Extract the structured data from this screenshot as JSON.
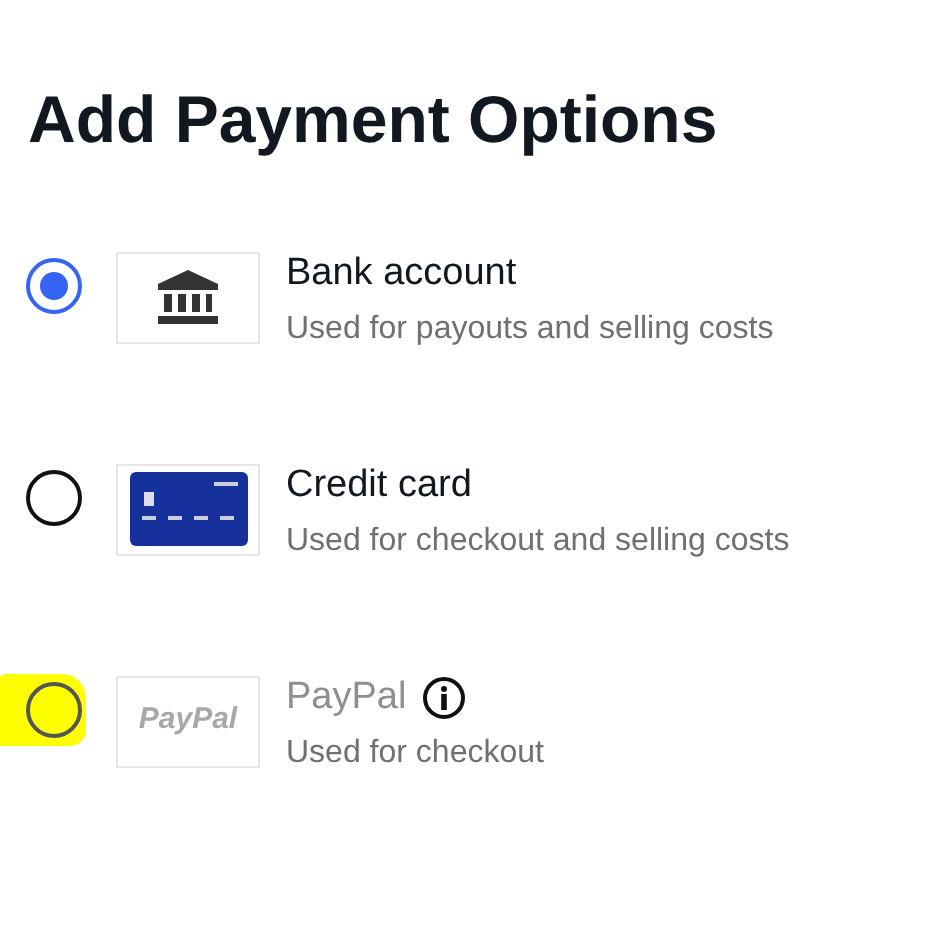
{
  "title": "Add Payment Options",
  "options": [
    {
      "kind": "bank",
      "label": "Bank account",
      "description": "Used for payouts and selling costs",
      "selected": true,
      "disabled": false,
      "highlighted": false,
      "info": false
    },
    {
      "kind": "card",
      "label": "Credit card",
      "description": "Used for checkout and selling costs",
      "selected": false,
      "disabled": false,
      "highlighted": false,
      "info": false
    },
    {
      "kind": "paypal",
      "label": "PayPal",
      "logo_text": "PayPal",
      "description": "Used for checkout",
      "selected": false,
      "disabled": true,
      "highlighted": true,
      "info": true
    }
  ]
}
